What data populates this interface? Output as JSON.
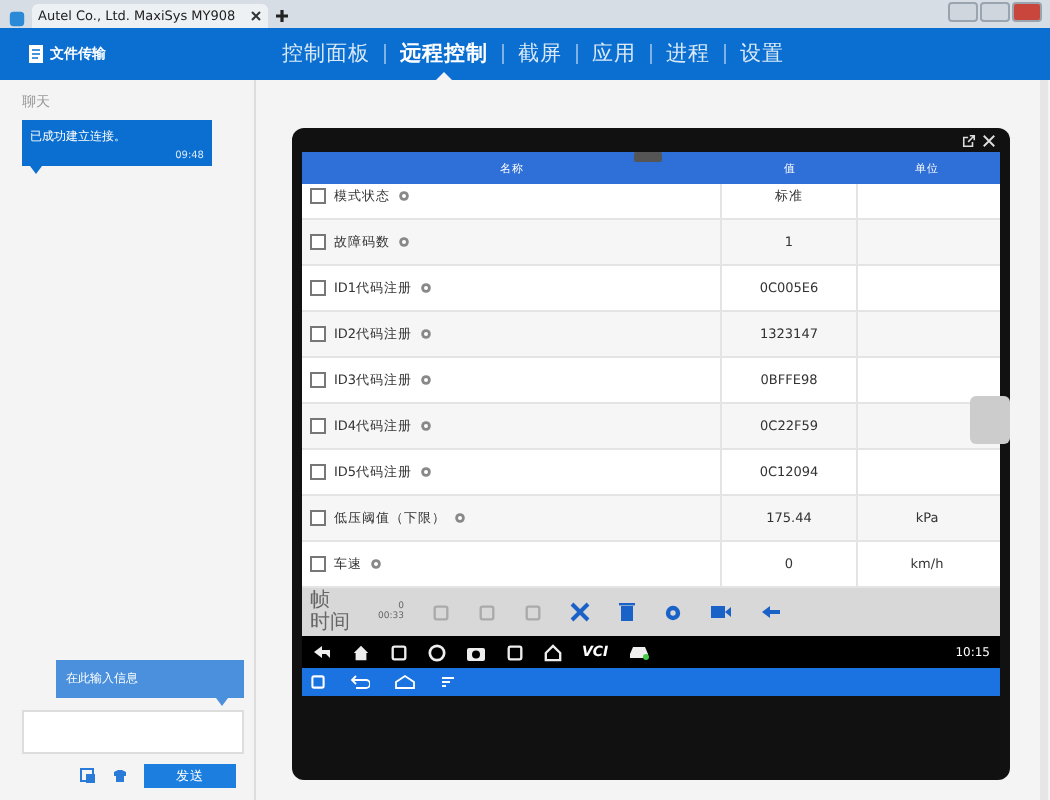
{
  "browser_tab": {
    "title": "Autel Co., Ltd. MaxiSys MY908"
  },
  "header": {
    "file_transfer": "文件传输",
    "tabs": [
      {
        "label": "控制面板",
        "selected": false
      },
      {
        "label": "远程控制",
        "selected": true
      },
      {
        "label": "截屏",
        "selected": false
      },
      {
        "label": "应用",
        "selected": false
      },
      {
        "label": "进程",
        "selected": false
      },
      {
        "label": "设置",
        "selected": false
      }
    ]
  },
  "chat": {
    "title": "聊天",
    "messages": [
      {
        "text": "已成功建立连接。",
        "time": "09:48"
      }
    ],
    "hint": "在此输入信息",
    "send": "发送"
  },
  "device": {
    "table": {
      "columns": [
        "名称",
        "值",
        "单位"
      ],
      "rows": [
        {
          "name": "模式状态",
          "value": "标准",
          "checked": false
        },
        {
          "name": "故障码数",
          "value": "1",
          "checked": false
        },
        {
          "name": "ID1代码注册",
          "value": "0C005E6",
          "checked": false
        },
        {
          "name": "ID2代码注册",
          "value": "1323147",
          "checked": false
        },
        {
          "name": "ID3代码注册",
          "value": "0BFFE98",
          "checked": false
        },
        {
          "name": "ID4代码注册",
          "value": "0C22F59",
          "checked": false
        },
        {
          "name": "ID5代码注册",
          "value": "0C12094",
          "checked": false
        },
        {
          "name": "低压阈值（下限）",
          "value": "175.44",
          "unit": "kPa",
          "checked": false
        },
        {
          "name": "车速",
          "value": "0",
          "unit": "km/h",
          "checked": false
        }
      ]
    },
    "toolbar": {
      "frame_label": "帧",
      "time_label": "时间",
      "frame": "0",
      "time": "00:33"
    },
    "status": {
      "vci": "VCI",
      "clock": "10:15"
    }
  }
}
